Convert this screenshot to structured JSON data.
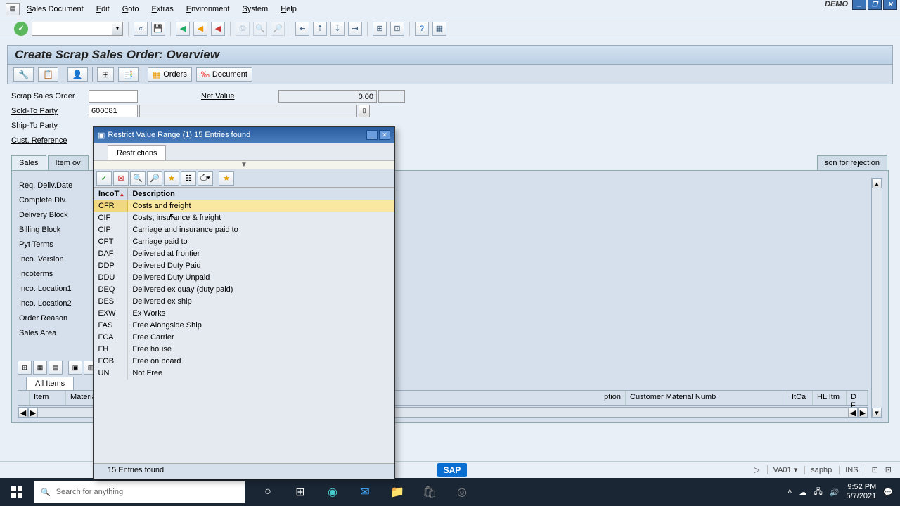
{
  "menubar": [
    "Sales Document",
    "Edit",
    "Goto",
    "Extras",
    "Environment",
    "System",
    "Help"
  ],
  "demo": "DEMO",
  "title": "Create Scrap Sales Order: Overview",
  "appbar": {
    "orders": "Orders",
    "document": "Document"
  },
  "form": {
    "scrap_label": "Scrap Sales Order",
    "netvalue_label": "Net Value",
    "netvalue": "0.00",
    "soldto_label": "Sold-To Party",
    "soldto": "600081",
    "shipto_label": "Ship-To Party",
    "custref_label": "Cust. Reference"
  },
  "tabs": [
    "Sales",
    "Item ov",
    "son for rejection"
  ],
  "side_labels": [
    "Req. Deliv.Date",
    "Complete Dlv.",
    "Delivery Block",
    "Billing Block",
    "Pyt Terms",
    "Inco. Version",
    "Incoterms",
    "Inco. Location1",
    "Inco. Location2",
    "Order Reason",
    "Sales Area"
  ],
  "all_items": "All Items",
  "grid_cols": {
    "item": "Item",
    "material": "Material",
    "ption": "ption",
    "custmat": "Customer Material Numb",
    "itca": "ItCa",
    "hlitm": "HL Itm",
    "df": "D F"
  },
  "popup": {
    "title": "Restrict Value Range (1)   15 Entries found",
    "tab": "Restrictions",
    "col1": "IncoT",
    "col2": "Description",
    "rows": [
      {
        "code": "CFR",
        "desc": "Costs and freight"
      },
      {
        "code": "CIF",
        "desc": "Costs, insurance & freight"
      },
      {
        "code": "CIP",
        "desc": "Carriage and insurance paid to"
      },
      {
        "code": "CPT",
        "desc": "Carriage paid to"
      },
      {
        "code": "DAF",
        "desc": "Delivered at frontier"
      },
      {
        "code": "DDP",
        "desc": "Delivered Duty Paid"
      },
      {
        "code": "DDU",
        "desc": "Delivered Duty Unpaid"
      },
      {
        "code": "DEQ",
        "desc": "Delivered ex quay (duty paid)"
      },
      {
        "code": "DES",
        "desc": "Delivered ex ship"
      },
      {
        "code": "EXW",
        "desc": "Ex Works"
      },
      {
        "code": "FAS",
        "desc": "Free Alongside Ship"
      },
      {
        "code": "FCA",
        "desc": "Free Carrier"
      },
      {
        "code": "FH",
        "desc": "Free house"
      },
      {
        "code": "FOB",
        "desc": "Free on board"
      },
      {
        "code": "UN",
        "desc": "Not Free"
      }
    ],
    "footer": "15 Entries found"
  },
  "status": {
    "tcode": "VA01",
    "server": "saphp",
    "mode": "INS"
  },
  "taskbar": {
    "search_placeholder": "Search for anything",
    "time": "9:52 PM",
    "date": "5/7/2021"
  }
}
